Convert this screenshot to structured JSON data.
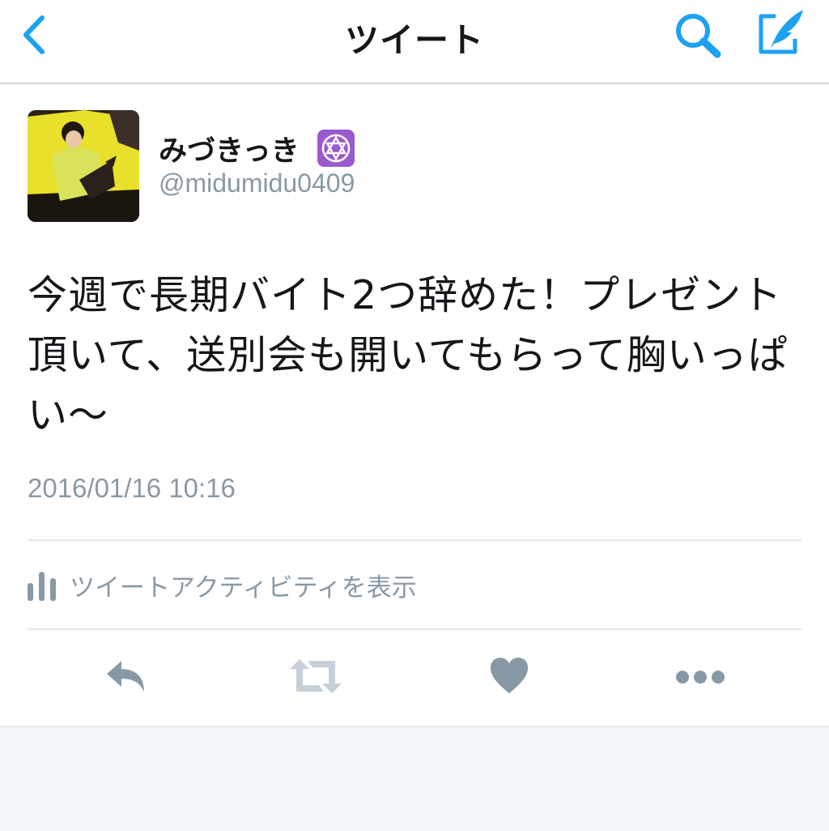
{
  "navbar": {
    "title": "ツイート",
    "back_icon": "chevron-left-icon",
    "search_icon": "search-icon",
    "compose_icon": "compose-tweet-icon"
  },
  "tweet": {
    "display_name": "みづきっき",
    "badge_icon": "star-of-david-icon",
    "handle": "@midumidu0409",
    "text": "今週で長期バイト2つ辞めた！プレゼント頂いて、送別会も開いてもらって胸いっぱい〜",
    "timestamp": "2016/01/16 10:16",
    "activity_label": "ツイートアクティビティを表示"
  },
  "actions": [
    "reply-icon",
    "retweet-icon",
    "like-icon",
    "more-icon"
  ],
  "colors": {
    "accent": "#1da1f2",
    "muted": "#8899a6",
    "text": "#14171a",
    "badge": "#9b59d0"
  }
}
